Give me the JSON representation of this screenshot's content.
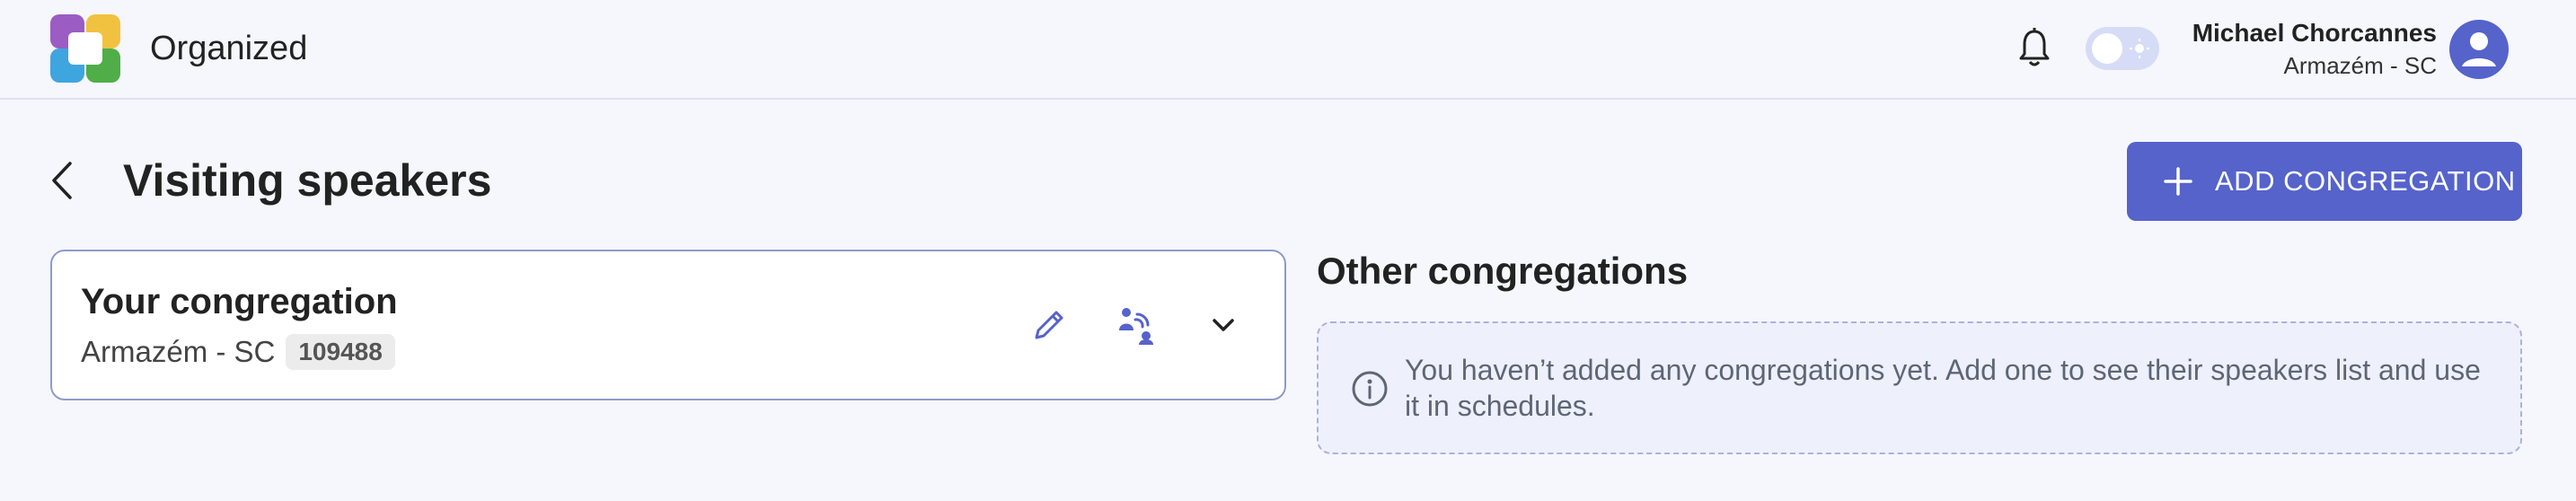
{
  "header": {
    "app_name": "Organized",
    "user_name": "Michael Chorcannes",
    "user_location": "Armazém - SC",
    "icons": [
      "app-logo",
      "bell-icon",
      "theme-toggle",
      "user-avatar-icon"
    ]
  },
  "page": {
    "title": "Visiting speakers",
    "add_button_label": "ADD CONGREGATION"
  },
  "your_congregation": {
    "title": "Your congregation",
    "location": "Armazém - SC",
    "code": "109488"
  },
  "other_congregations": {
    "title": "Other congregations",
    "empty_message": "You haven’t added any congregations yet. Add one to see their speakers list and use it in schedules."
  },
  "colors": {
    "accent": "#5563cb",
    "background": "#f6f7fc",
    "card_border": "#8f9ac9",
    "info_bg": "#eef0fb"
  }
}
